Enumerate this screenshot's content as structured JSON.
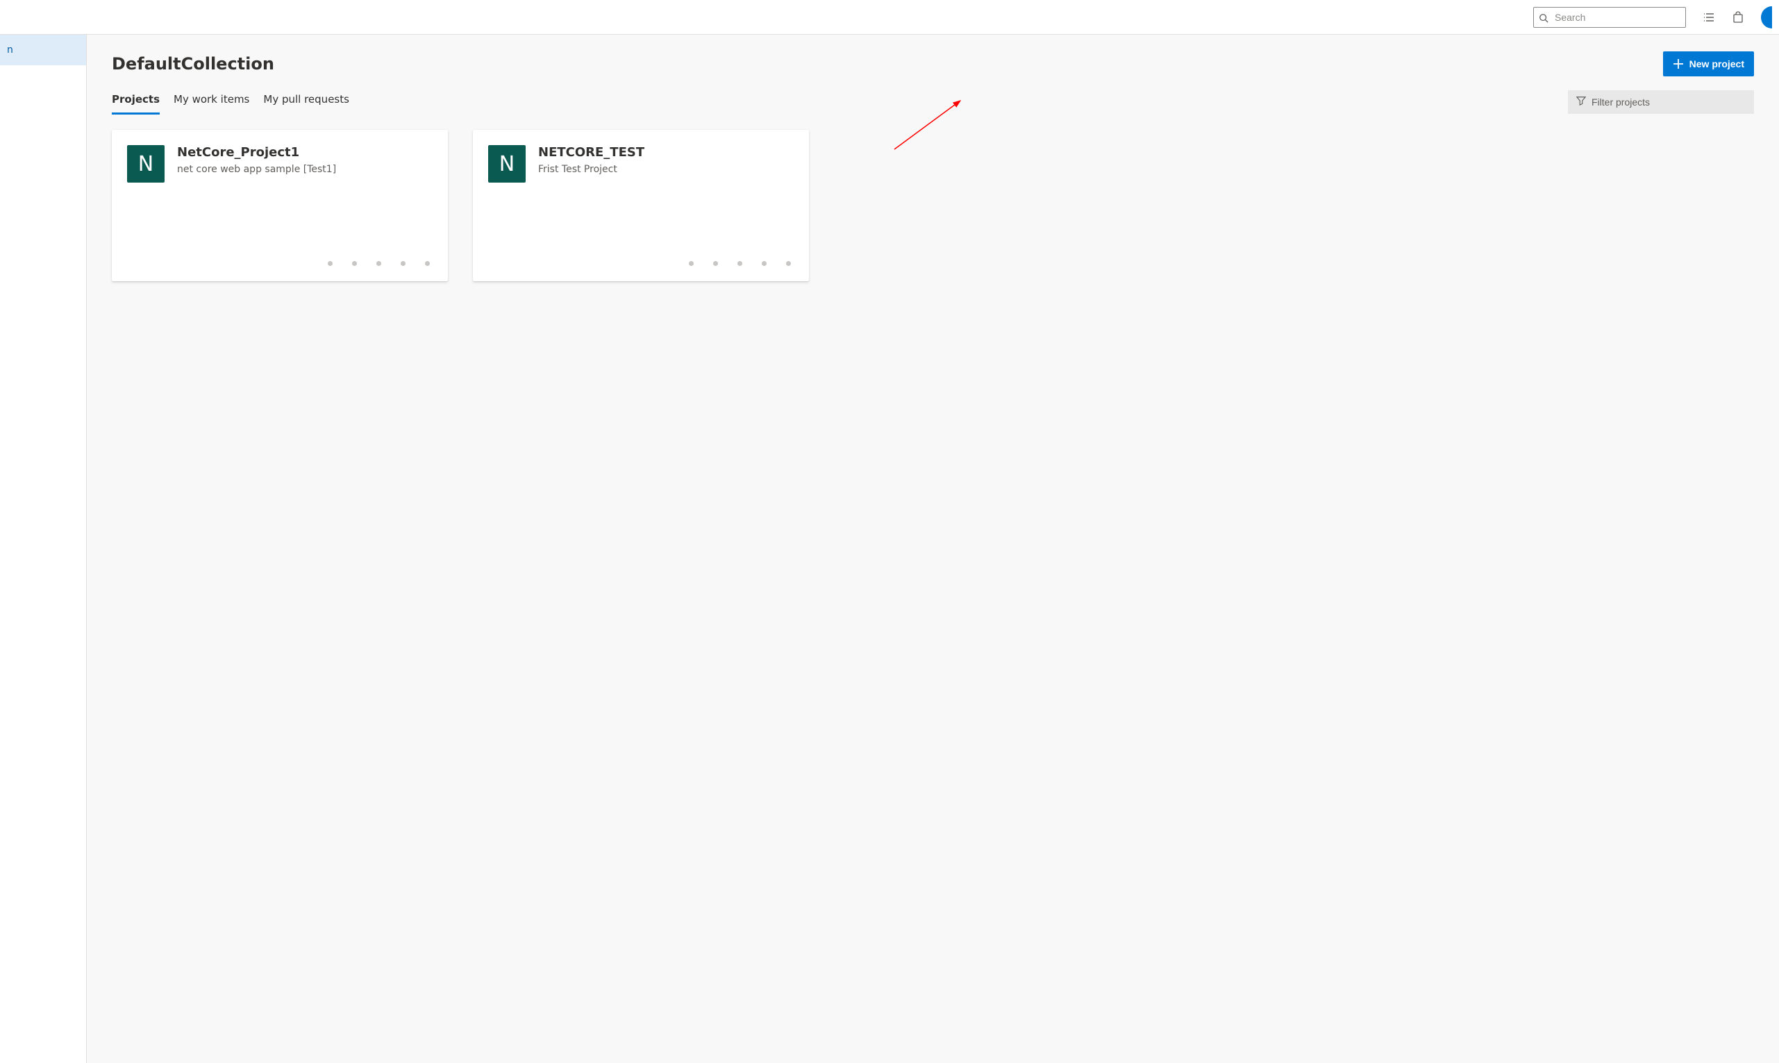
{
  "header": {
    "search_placeholder": "Search"
  },
  "sidebar": {
    "items": [
      {
        "label": "n"
      }
    ]
  },
  "page": {
    "title": "DefaultCollection",
    "new_project_label": "New project"
  },
  "tabs": [
    {
      "label": "Projects",
      "active": true
    },
    {
      "label": "My work items",
      "active": false
    },
    {
      "label": "My pull requests",
      "active": false
    }
  ],
  "filter": {
    "placeholder": "Filter projects"
  },
  "projects": [
    {
      "avatar_letter": "N",
      "title": "NetCore_Project1",
      "description": "net core web app sample [Test1]",
      "avatar_color": "#0b5a51"
    },
    {
      "avatar_letter": "N",
      "title": "NETCORE_TEST",
      "description": "Frist Test Project",
      "avatar_color": "#0b5a51"
    }
  ]
}
